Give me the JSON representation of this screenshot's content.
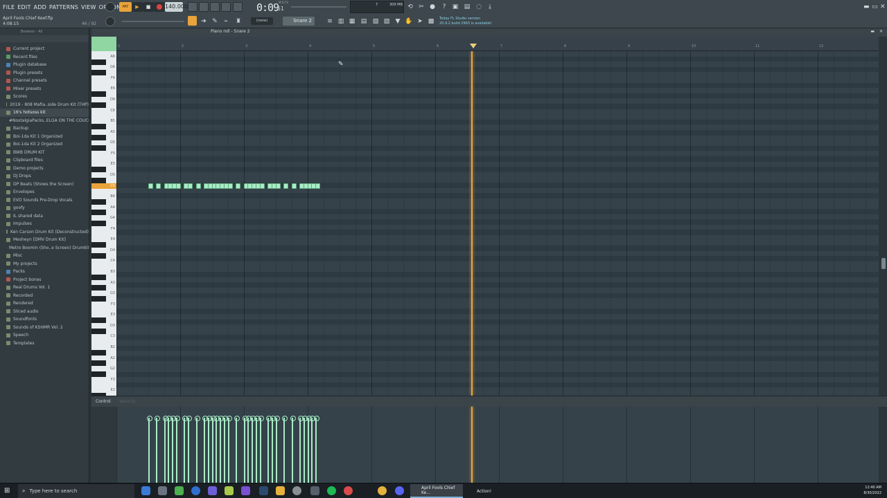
{
  "menu": [
    "FILE",
    "EDIT",
    "ADD",
    "PATTERNS",
    "VIEW",
    "OPTIONS",
    "TOOLS",
    "HELP"
  ],
  "project": {
    "name": "April Fools Chief Keef.flp",
    "time": "4:08:15",
    "count": "46 / 92"
  },
  "transport": {
    "tempo": "140.000",
    "time_main": "0:09",
    "time_sub": "61",
    "time_tag": "M:S:CS",
    "voices": "7",
    "cpu": "309 MB"
  },
  "news": {
    "line1": "Today  FL Studio version",
    "line2": "20.9.2 build 2963 is available!"
  },
  "channel": {
    "none_label": "(none)",
    "selected": "Snare 2"
  },
  "browser": {
    "title": "Browser - All",
    "items": [
      {
        "label": "Current project",
        "icon": "ic-red"
      },
      {
        "label": "Recent files",
        "icon": "ic-green"
      },
      {
        "label": "Plugin database",
        "icon": "ic-blue"
      },
      {
        "label": "Plugin presets",
        "icon": "ic-red"
      },
      {
        "label": "Channel presets",
        "icon": "ic-red"
      },
      {
        "label": "Mixer presets",
        "icon": "ic-red"
      },
      {
        "label": "Scores",
        "icon": "ic-fold"
      },
      {
        "label": "2019 - 808 Mafia..side Drum Kit (THP)",
        "icon": "ic-fold"
      },
      {
        "label": "16's hotsoss kit",
        "icon": "ic-fold",
        "highlight": true
      },
      {
        "label": "#NostalgiaPacks..ELGA ON THE COUCH",
        "icon": "ic-fold"
      },
      {
        "label": "Backup",
        "icon": "ic-fold"
      },
      {
        "label": "Boi-1da Kit 1 Organized",
        "icon": "ic-fold"
      },
      {
        "label": "Boi-1da Kit 2 Organized",
        "icon": "ic-fold"
      },
      {
        "label": "BWB DRUM KIT",
        "icon": "ic-fold"
      },
      {
        "label": "Clipboard files",
        "icon": "ic-fold"
      },
      {
        "label": "Demo projects",
        "icon": "ic-fold"
      },
      {
        "label": "DJ Drops",
        "icon": "ic-fold"
      },
      {
        "label": "DP Beats (Shows the Screen)",
        "icon": "ic-fold"
      },
      {
        "label": "Envelopes",
        "icon": "ic-fold"
      },
      {
        "label": "EVO Sounds Pre-Drop Vocals",
        "icon": "ic-fold"
      },
      {
        "label": "goofy",
        "icon": "ic-fold"
      },
      {
        "label": "IL shared data",
        "icon": "ic-fold"
      },
      {
        "label": "Impulses",
        "icon": "ic-fold"
      },
      {
        "label": "Ken Carson Drum Kit (Deconstructed)",
        "icon": "ic-fold"
      },
      {
        "label": "Mesheyn [DMV Drum Kit]",
        "icon": "ic-fold"
      },
      {
        "label": "Metro Boomin (Sho..e Screen) Drumkit",
        "icon": "ic-fold"
      },
      {
        "label": "Misc",
        "icon": "ic-fold"
      },
      {
        "label": "My projects",
        "icon": "ic-fold"
      },
      {
        "label": "Packs",
        "icon": "ic-blue"
      },
      {
        "label": "Project bones",
        "icon": "ic-red"
      },
      {
        "label": "Real Drums Vol. 1",
        "icon": "ic-fold"
      },
      {
        "label": "Recorded",
        "icon": "ic-fold"
      },
      {
        "label": "Rendered",
        "icon": "ic-fold"
      },
      {
        "label": "Sliced audio",
        "icon": "ic-fold"
      },
      {
        "label": "Soundfonts",
        "icon": "ic-fold"
      },
      {
        "label": "Sounds of KSHMR Vol. 2",
        "icon": "ic-fold"
      },
      {
        "label": "Speech",
        "icon": "ic-fold"
      },
      {
        "label": "Templates",
        "icon": "ic-fold"
      }
    ]
  },
  "piano_roll": {
    "title": "Piano roll - Snare 2",
    "ruler_bars": [
      "1",
      "2",
      "3",
      "4",
      "5",
      "6",
      "7",
      "8",
      "9",
      "10",
      "11",
      "12"
    ],
    "key_labels": [
      "A6",
      "G6",
      "F6",
      "E6",
      "D6",
      "C6",
      "B5",
      "A5",
      "G5",
      "F5",
      "E5",
      "D5",
      "C5",
      "B4",
      "A4",
      "G4",
      "F4",
      "E4",
      "D4",
      "C4",
      "B3",
      "A3",
      "G3",
      "F3",
      "E3",
      "D3",
      "C3",
      "B2",
      "A2",
      "G2",
      "F2",
      "E2"
    ],
    "highlight_key": "C5",
    "notes_beats": [
      1.5,
      2,
      2.5,
      2.75,
      3,
      3.25,
      3.75,
      4,
      4.5,
      5,
      5.25,
      5.5,
      5.75,
      6,
      6.25,
      6.5,
      7,
      7.5,
      7.75,
      8,
      8.25,
      8.5,
      9,
      9.25,
      9.5,
      10,
      10.5,
      11,
      11.25,
      11.5,
      11.75,
      12
    ],
    "playhead_beat": 8.5
  },
  "control": {
    "label": "Control",
    "sublabel": "Velocity"
  },
  "taskbar": {
    "search_placeholder": "Type here to search",
    "window1": "April Fools Chief Ke...",
    "window2": "Action!",
    "time": "12:40 AM",
    "date": "8/30/2022"
  },
  "colors": {
    "accent": "#e8a33b",
    "note": "#a9ecc6",
    "grid": "#35424a"
  }
}
